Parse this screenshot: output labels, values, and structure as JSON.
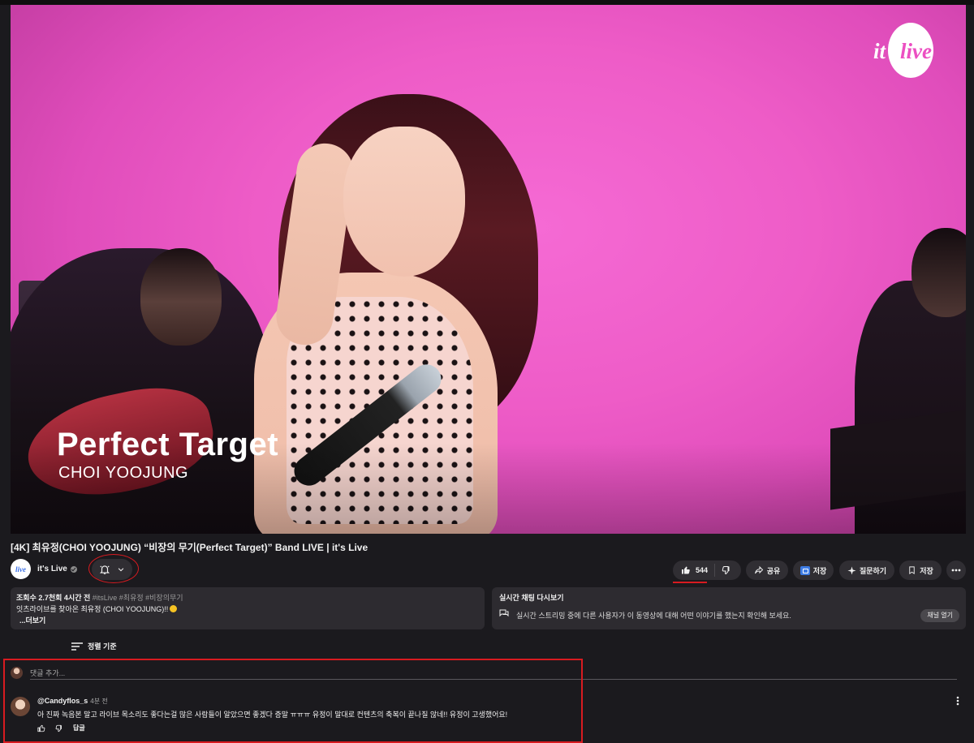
{
  "video": {
    "overlay_title": "Perfect Target",
    "overlay_artist": "CHOI YOOJUNG",
    "logo_part1": "it's",
    "logo_part2": "live"
  },
  "title": "[4K] 최유정(CHOI YOOJUNG) “비장의 무기(Perfect Target)” Band LIVE | it's Live",
  "channel": {
    "name": "it's Live",
    "avatar_text": "live"
  },
  "actions": {
    "likes": "544",
    "share": "공유",
    "save1": "저장",
    "ask": "질문하기",
    "save2": "저장"
  },
  "description": {
    "stats": "조회수 2.7천회  4시간 전",
    "tags": "#itsLive #최유정 #비장의무기",
    "line": "잇츠라이브를 찾아온 최유정 (CHOI YOOJUNG)!!",
    "more": "...더보기"
  },
  "live_chat": {
    "title": "실시간 채팅 다시보기",
    "desc": "실시간 스트리밍 중에 다른 사용자가 이 동영상에 대해 어떤 이야기를 했는지 확인해 보세요.",
    "button": "채널 열기"
  },
  "comments": {
    "sort_label": "정렬 기준",
    "input_placeholder": "댓글 추가...",
    "items": [
      {
        "author": "@Candyflos_s",
        "time": "4분 전",
        "text": "아 진짜 녹음본 말고 라이브 목소리도 좋다는걸 많은 사람들이 알았으면 좋겠다 증말 ㅠㅠㅠ 유정이 말대로 컨텐츠의 축복이 끝나질 않네!! 유정이 고생했어요!",
        "reply": "답글"
      }
    ]
  },
  "colors": {
    "background": "#1b1a1e",
    "pill": "#302e33",
    "annotation_red": "#d81b20",
    "video_pink": "#ee5cc7"
  }
}
